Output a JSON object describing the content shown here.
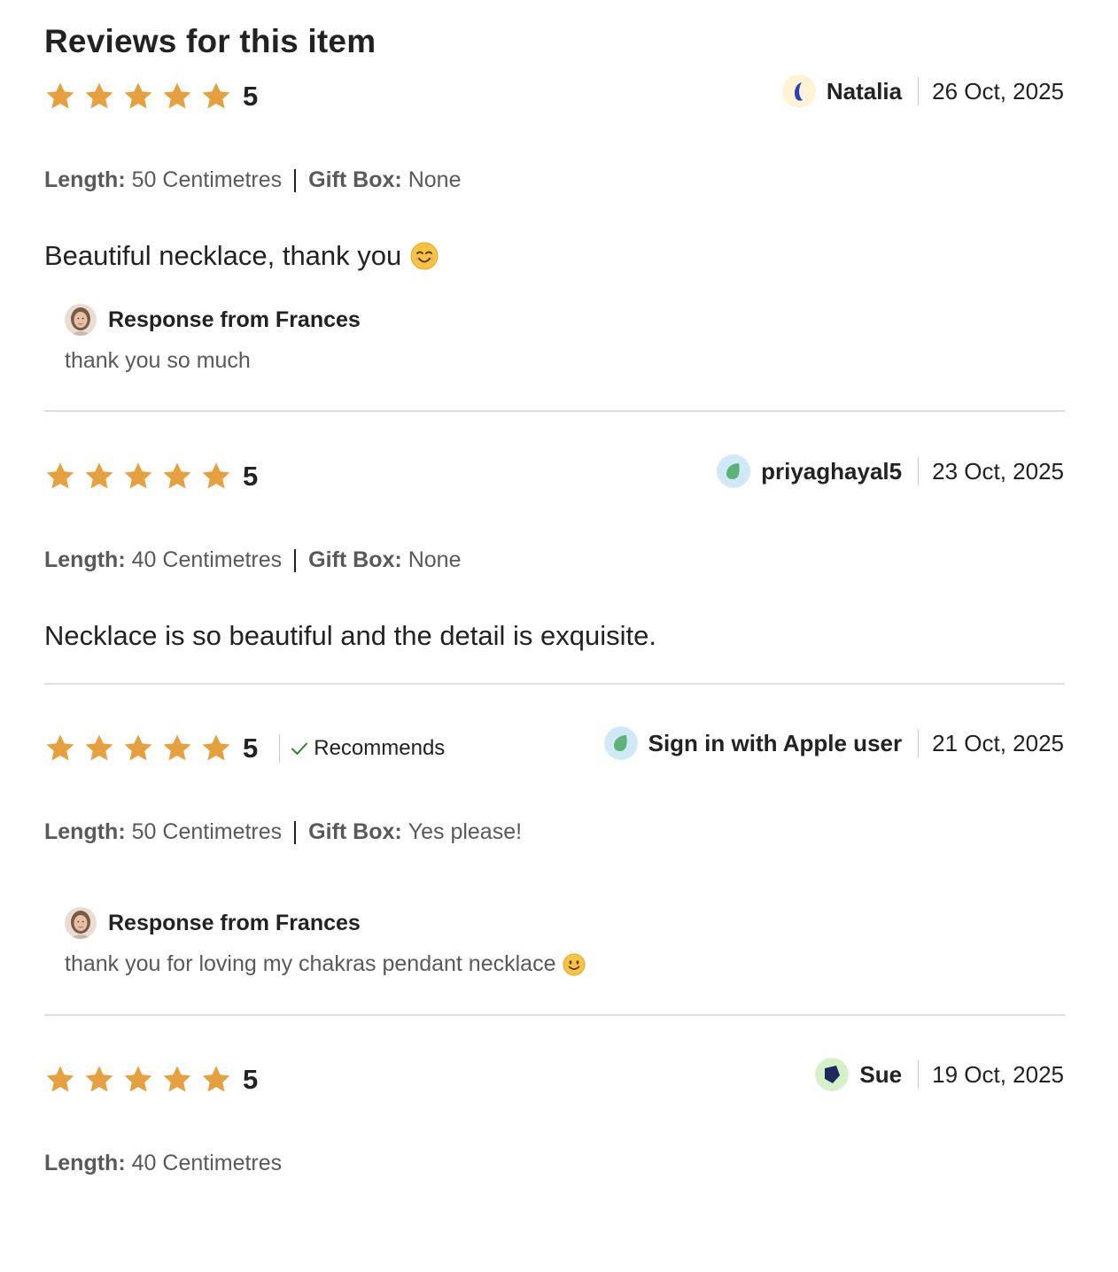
{
  "page": {
    "title": "Reviews for this item"
  },
  "colors": {
    "star": "#E6A03F",
    "check": "#2E7D32",
    "divider": "#dedede"
  },
  "reviews": [
    {
      "rating": "5",
      "reviewer": "Natalia",
      "date": "26 Oct, 2025",
      "avatar": "crescent-avatar-icon",
      "variations": [
        {
          "key": "Length:",
          "value": "50 Centimetres"
        },
        {
          "key": "Gift Box:",
          "value": "None"
        }
      ],
      "text": "Beautiful necklace, thank you",
      "text_emoji": "smiling-face-emoji",
      "response": {
        "title": "Response from Frances",
        "text": "thank you so much"
      }
    },
    {
      "rating": "5",
      "reviewer": "priyaghayal5",
      "date": "23 Oct, 2025",
      "avatar": "leaf-avatar-icon",
      "variations": [
        {
          "key": "Length:",
          "value": "40 Centimetres"
        },
        {
          "key": "Gift Box:",
          "value": "None"
        }
      ],
      "text": "Necklace is so beautiful and the detail is exquisite."
    },
    {
      "rating": "5",
      "recommends": "Recommends",
      "reviewer": "Sign in with Apple user",
      "date": "21 Oct, 2025",
      "avatar": "leaf-avatar-icon",
      "variations": [
        {
          "key": "Length:",
          "value": "50 Centimetres"
        },
        {
          "key": "Gift Box:",
          "value": "Yes please!"
        }
      ],
      "response": {
        "title": "Response from Frances",
        "text": "thank you for loving my chakras pendant necklace",
        "text_emoji": "slightly-smiling-face-emoji"
      }
    },
    {
      "rating": "5",
      "reviewer": "Sue",
      "date": "19 Oct, 2025",
      "avatar": "pentagon-avatar-icon",
      "variations": [
        {
          "key": "Length:",
          "value": "40 Centimetres"
        }
      ]
    }
  ]
}
